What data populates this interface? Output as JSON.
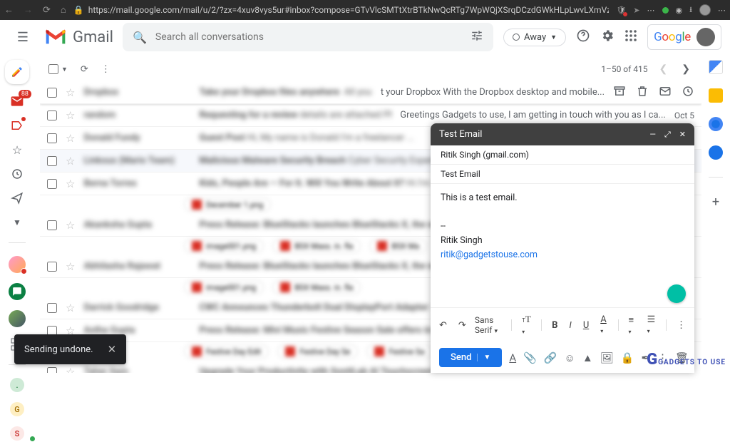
{
  "browser": {
    "url": "https://mail.google.com/mail/u/2/?zx=4xuv8vys5ur#inbox?compose=GTvVlcSMTtXtrBTkNwQcRTg7WpWQjXSrqDCzdGWkHLpLwvLXmVzTZtCDXdqlkzXG..."
  },
  "header": {
    "brand": "Gmail",
    "search_placeholder": "Search all conversations",
    "status_chip": "Away",
    "google_logo": "Google"
  },
  "toolbar": {
    "pager": "1–50 of 415"
  },
  "rail": {
    "inbox_badge": "88"
  },
  "messages": {
    "row1_snippet": "t your Dropbox With the Dropbox desktop and mobile...",
    "row2_snippet": "Greetings Gadgets to use, I am getting in touch with you as I ca...",
    "row2_date": "Oct 5"
  },
  "compose": {
    "title": "Test Email",
    "to": "Ritik Singh (gmail.com)",
    "subject": "Test Email",
    "body_line": "This is a test email.",
    "sig_name": "Ritik Singh",
    "sig_email": "ritik@gadgetstouse.com",
    "font": "Sans Serif",
    "send": "Send"
  },
  "toast": {
    "text": "Sending undone."
  },
  "watermark": "GADGETS TO USE"
}
